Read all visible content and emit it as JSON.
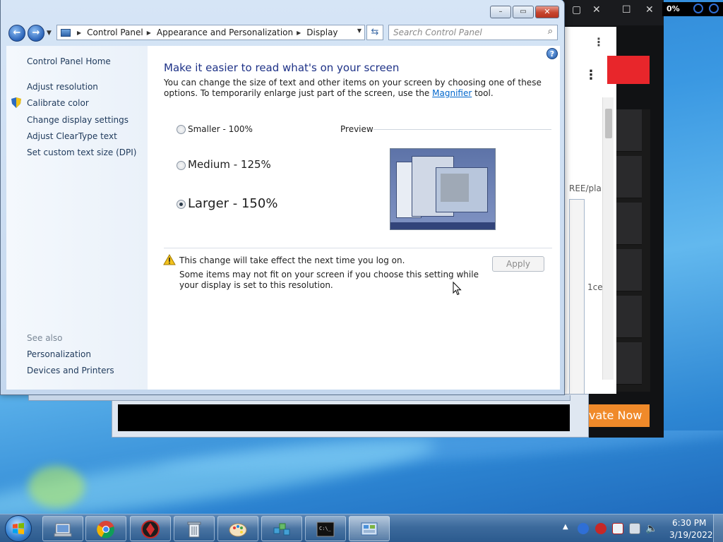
{
  "window": {
    "minimize_glyph": "–",
    "maximize_glyph": "▭",
    "close_glyph": "✕"
  },
  "address": {
    "crumbs": [
      "Control Panel",
      "Appearance and Personalization",
      "Display"
    ],
    "search_placeholder": "Search Control Panel"
  },
  "sidebar": {
    "home": "Control Panel Home",
    "items": [
      "Adjust resolution",
      "Calibrate color",
      "Change display settings",
      "Adjust ClearType text",
      "Set custom text size (DPI)"
    ],
    "see_also_label": "See also",
    "see_also": [
      "Personalization",
      "Devices and Printers"
    ]
  },
  "main": {
    "title": "Make it easier to read what's on your screen",
    "intro_before": "You can change the size of text and other items on your screen by choosing one of these options. To temporarily enlarge just part of the screen, use the ",
    "intro_link": "Magnifier",
    "intro_after": " tool.",
    "options": [
      {
        "label": "Smaller - 100%",
        "selected": false
      },
      {
        "label": "Medium - 125%",
        "selected": false
      },
      {
        "label": "Larger - 150%",
        "selected": true
      }
    ],
    "preview_label": "Preview",
    "warning_title": "This change will take effect the next time you log on.",
    "warning_note": "Some items may not fit on your screen if you choose this setting while your display is set to this resolution.",
    "apply_label": "Apply"
  },
  "background": {
    "percent": "0%",
    "url_fragment": "REE/pla",
    "text_fragment": "1ce",
    "activate_label": "vate Now"
  },
  "taskbar": {
    "apps": [
      "chrome",
      "antivirus",
      "recycle-bin",
      "paint",
      "network",
      "command-prompt",
      "control-panel"
    ],
    "time": "6:30 PM",
    "date": "3/19/2022"
  },
  "colors": {
    "title_blue": "#1e3287",
    "link_blue": "#0066cc",
    "close_red": "#c6452f",
    "activate_orange": "#f08a2a"
  }
}
